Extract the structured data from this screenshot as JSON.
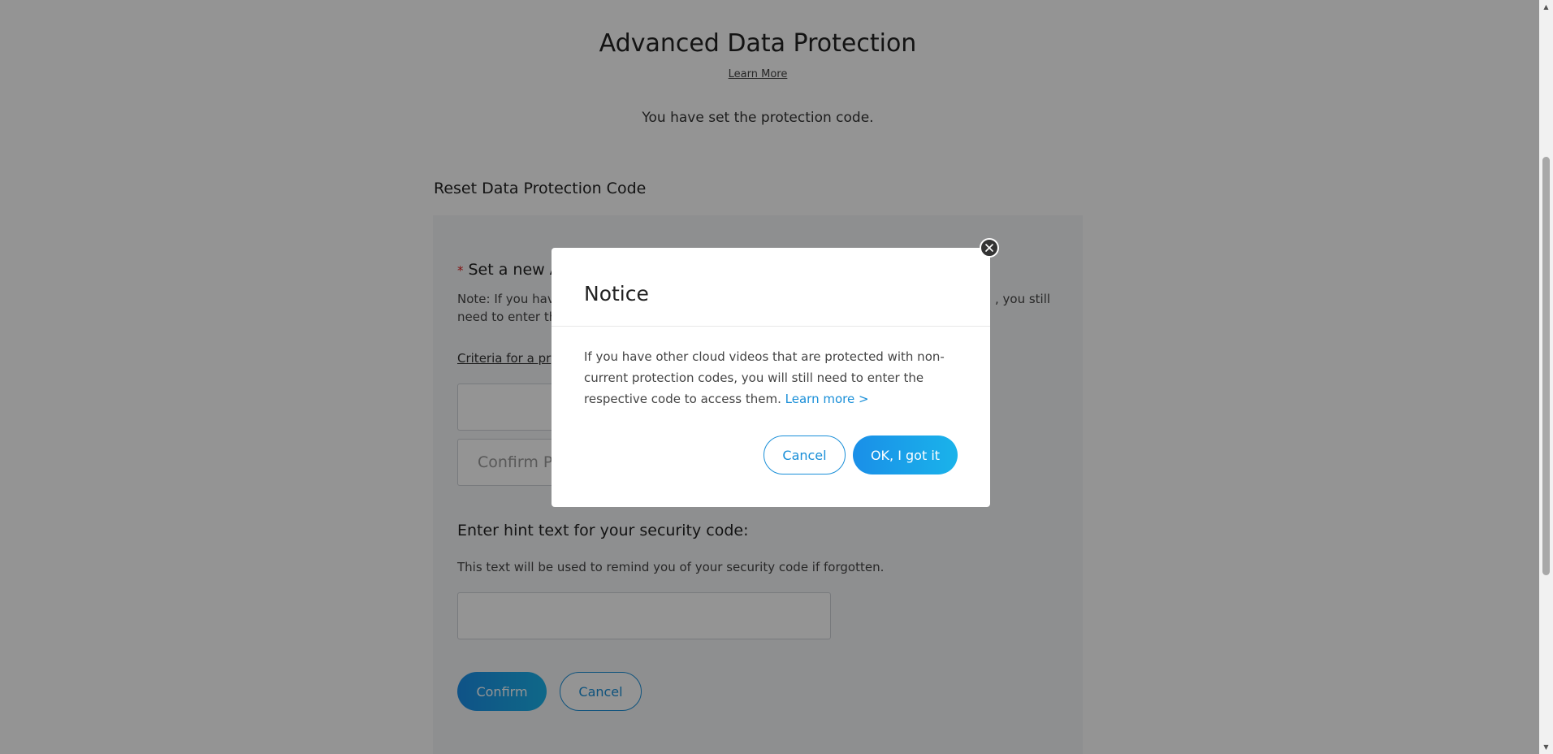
{
  "header": {
    "title": "Advanced Data Protection",
    "learn_more": "Learn More",
    "status": "You have set the protection code."
  },
  "form": {
    "section_title": "Reset Data Protection Code",
    "required_mark": "*",
    "field_label": "Set a new A",
    "note": "Note: If you hav",
    "note_tail": ", you still",
    "note_line2": "need to enter th",
    "criteria_link": "Criteria for a pr",
    "confirm_placeholder": "Confirm P",
    "hint_label": "Enter hint text for your security code:",
    "hint_description": "This text will be used to remind you of your security code if forgotten.",
    "confirm_button": "Confirm",
    "cancel_button": "Cancel"
  },
  "modal": {
    "title": "Notice",
    "body": "If you have other cloud videos that are protected with non-current protection codes, you will still need to enter the respective code to access them.",
    "link": "Learn more >",
    "cancel_button": "Cancel",
    "ok_button": "OK, I got it",
    "close_icon": "close-icon"
  },
  "colors": {
    "accent": "#1a8fd8",
    "required": "#e02020",
    "overlay": "rgba(0,0,0,0.42)"
  }
}
